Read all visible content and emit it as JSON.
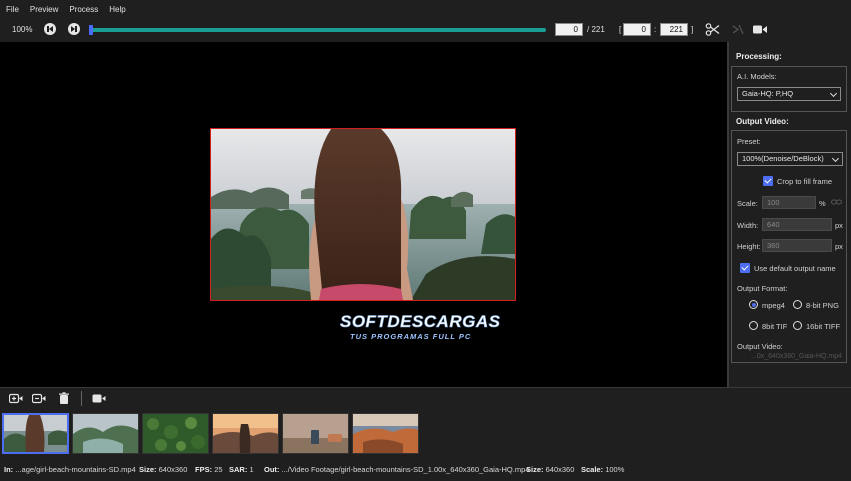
{
  "menu": [
    "File",
    "Preview",
    "Process",
    "Help"
  ],
  "toolbar": {
    "zoom": "100%",
    "frame_current": "0",
    "frame_total": "/ 221",
    "range_open": "[",
    "range_start": "0",
    "range_colon": ":",
    "range_end": "221",
    "range_close": "]"
  },
  "watermark": {
    "title": "SOFTDESCARGAS",
    "subtitle": "TUS PROGRAMAS FULL PC"
  },
  "panel": {
    "processing_title": "Processing:",
    "ai_models_label": "A.I. Models:",
    "ai_model_value": "Gaia-HQ: P,HQ",
    "output_video_title": "Output Video:",
    "preset_label": "Preset:",
    "preset_value": "100%(Denoise/DeBlock)",
    "crop_label": "Crop to fill frame",
    "crop_checked": true,
    "scale_label": "Scale:",
    "scale_value": "100",
    "scale_unit": "%",
    "width_label": "Width:",
    "width_value": "640",
    "width_unit": "px",
    "height_label": "Height:",
    "height_value": "360",
    "height_unit": "px",
    "default_name_label": "Use default output name",
    "default_name_checked": true,
    "format_label": "Output Format:",
    "formats": [
      {
        "label": "mpeg4",
        "selected": true
      },
      {
        "label": "8-bit PNG",
        "selected": false
      },
      {
        "label": "8bit TIF",
        "selected": false
      },
      {
        "label": "16bit TIFF",
        "selected": false
      }
    ],
    "output_video_label": "Output Video:",
    "output_video_name": "...0x_640x360_Gaia-HQ.mp4"
  },
  "status": {
    "in_label": "In:",
    "in_value": "...age/girl-beach-mountains-SD.mp4",
    "size_label": "Size:",
    "size_value": "640x360",
    "fps_label": "FPS:",
    "fps_value": "25",
    "sar_label": "SAR:",
    "sar_value": "1",
    "out_label": "Out:",
    "out_value": ".../Video Footage/girl-beach-mountains-SD_1.00x_640x360_Gaia-HQ.mp4",
    "out_size_label": "Size:",
    "out_size_value": "640x360",
    "scale_label": "Scale:",
    "scale_value": "100%"
  },
  "colors": {
    "accent": "#4d6ef0",
    "slider": "#1a9d93",
    "frame_border": "#d02020"
  }
}
